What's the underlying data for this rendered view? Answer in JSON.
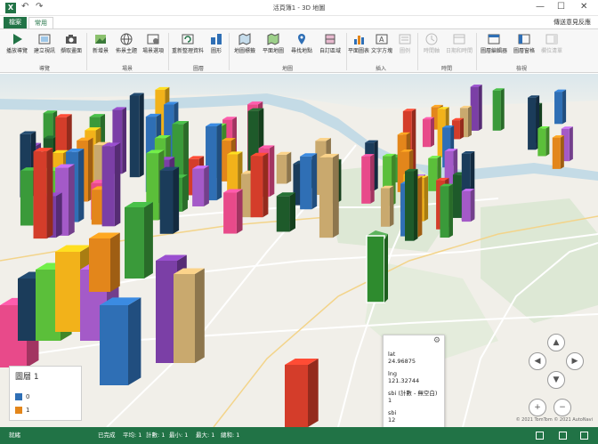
{
  "titlebar": {
    "app_icon": "X",
    "title": "活頁簿1 - 3D 地圖",
    "undo_icon": "↶",
    "redo_icon": "↷",
    "minimize": "—",
    "maximize": "☐",
    "close": "✕"
  },
  "tabs": {
    "file": "檔案",
    "home": "常用"
  },
  "feedback": "傳送意見反應",
  "ribbon": {
    "buttons": {
      "play_tour": "播放導覽",
      "create_video": "建立視訊",
      "capture_screen": "擷取畫面",
      "new_scene": "新增景",
      "themes": "佈景主題",
      "scene_options": "場景選項",
      "refresh_data": "重新整理資料",
      "shapes": "圖形",
      "map_labels": "地圖標籤",
      "flat_map": "平面地圖",
      "find_location": "尋找地點",
      "custom_regions": "自訂區域",
      "2d_chart": "平面圖表",
      "text_box": "文字方塊",
      "legend": "圖例",
      "timeline": "時間軸",
      "date_time": "日期和時間",
      "layer_pane": "圖層編輯器",
      "tour_editor": "圖層窗格",
      "field_list": "欄位清單"
    },
    "groups": {
      "tour": "導覽",
      "scene": "場景",
      "layer": "圖層",
      "map": "地圖",
      "insert": "插入",
      "time": "時間",
      "view": "檢視"
    }
  },
  "tooltip": {
    "gear_icon": "⚙",
    "lat_label": "lat",
    "lat_value": "24.96875",
    "lng_label": "lng",
    "lng_value": "121.32744",
    "count_label": "sbi (計數 - 無空白)",
    "count_value": "1",
    "sbi_label": "sbi",
    "sbi_value": "12"
  },
  "legend": {
    "title": "圖層 1",
    "items": [
      {
        "label": "0",
        "color": "#2f6fb5"
      },
      {
        "label": "1",
        "color": "#e3861b"
      }
    ]
  },
  "nav": {
    "up": "▲",
    "left": "◀",
    "right": "▶",
    "down": "▼",
    "zoom_in": "+",
    "zoom_out": "−"
  },
  "copyright": "© 2021 TomTom © 2021 AutoNavi",
  "statusbar": {
    "ready": "就緒",
    "completed": "已完成",
    "average": "平均: 1",
    "count": "計數: 1",
    "min": "最小: 1",
    "max": "最大: 1",
    "sum": "總和: 1"
  },
  "colors": {
    "excel_green": "#217346",
    "bar_palette": [
      "#2f6fb5",
      "#e3861b",
      "#3a9a3a",
      "#7b3fa6",
      "#c9a96e",
      "#d43d2a",
      "#1e5a2a",
      "#e84a8a",
      "#1b3c5a",
      "#5bbf3a",
      "#f2b21a",
      "#a45ac8"
    ]
  }
}
